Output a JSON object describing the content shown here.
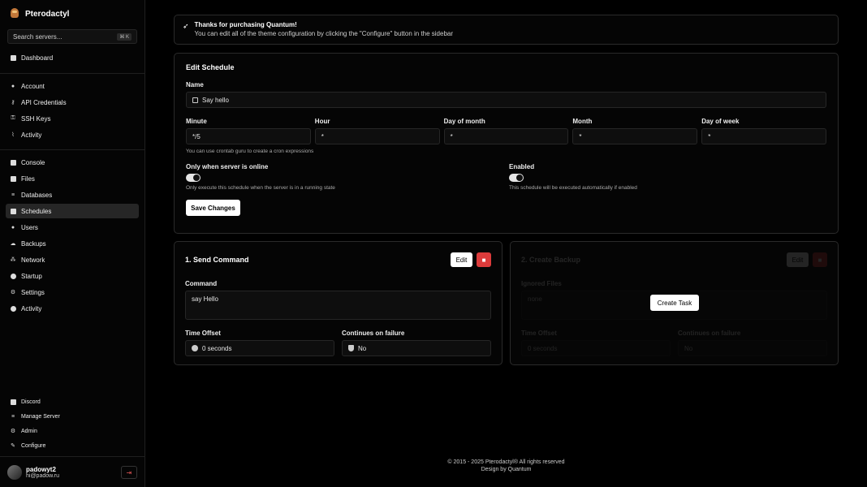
{
  "app": {
    "title": "Pterodactyl"
  },
  "search": {
    "placeholder": "Search servers...",
    "shortcut": "⌘ K"
  },
  "nav": {
    "dashboard": "Dashboard",
    "account": [
      "Account",
      "API Credentials",
      "SSH Keys",
      "Activity"
    ],
    "server": [
      "Console",
      "Files",
      "Databases",
      "Schedules",
      "Users",
      "Backups",
      "Network",
      "Startup",
      "Settings",
      "Activity"
    ],
    "active": "Schedules",
    "bottom": [
      "Discord",
      "Manage Server",
      "Admin",
      "Configure"
    ]
  },
  "user": {
    "name": "padowyt2",
    "email": "hi@padow.ru"
  },
  "notice": {
    "title": "Thanks for purchasing Quantum!",
    "text": "You can edit all of the theme configuration by clicking the \"Configure\" button in the sidebar"
  },
  "schedule": {
    "heading": "Edit Schedule",
    "name_label": "Name",
    "name_value": "Say hello",
    "cron": [
      {
        "label": "Minute",
        "value": "*/5"
      },
      {
        "label": "Hour",
        "value": "*"
      },
      {
        "label": "Day of month",
        "value": "*"
      },
      {
        "label": "Month",
        "value": "*"
      },
      {
        "label": "Day of week",
        "value": "*"
      }
    ],
    "cron_help": "You can use crontab guru to create a cron expressions",
    "only_online_label": "Only when server is online",
    "only_online_help": "Only execute this schedule when the server is in a running state",
    "only_online": true,
    "enabled_label": "Enabled",
    "enabled_help": "This schedule will be executed automatically if enabled",
    "enabled": true,
    "save_label": "Save Changes"
  },
  "tasks": [
    {
      "title": "1. Send Command",
      "edit_label": "Edit",
      "field_label": "Command",
      "field_value": "say Hello",
      "offset_label": "Time Offset",
      "offset_value": "0 seconds",
      "continue_label": "Continues on failure",
      "continue_value": "No"
    },
    {
      "title": "2. Create Backup",
      "edit_label": "Edit",
      "field_label": "Ignored Files",
      "field_value": "none",
      "offset_label": "Time Offset",
      "offset_value": "0 seconds",
      "continue_label": "Continues on failure",
      "continue_value": "No"
    }
  ],
  "create_task_label": "Create Task",
  "footer": {
    "line1": "© 2015 - 2025 Pterodactyl® All rights reserved",
    "line2": "Design by Quantum"
  },
  "colors": {
    "background": "#000000",
    "danger": "#dc3b3b",
    "button": "#ffffff"
  }
}
